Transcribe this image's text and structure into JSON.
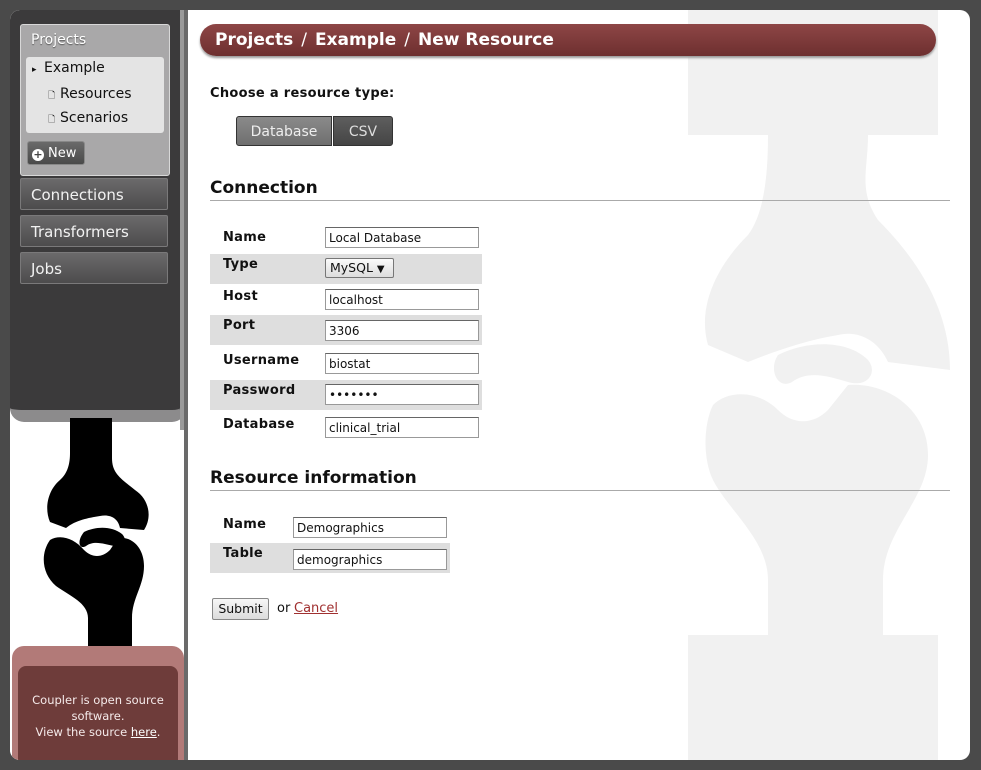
{
  "sidebar": {
    "projects_title": "Projects",
    "tree": [
      {
        "label": "Example",
        "glyph": "▸"
      },
      {
        "label": "Resources",
        "glyph": "🗋"
      },
      {
        "label": "Scenarios",
        "glyph": "🗋"
      }
    ],
    "new_label": "New",
    "nav": [
      "Connections",
      "Transformers",
      "Jobs"
    ]
  },
  "footer": {
    "line1": "Coupler is open source software.",
    "line2_prefix": "View the source ",
    "link": "here",
    "line2_suffix": "."
  },
  "breadcrumb": [
    "Projects",
    "Example",
    "New Resource"
  ],
  "breadcrumb_sep": "/",
  "resource_type": {
    "prompt": "Choose a resource type:",
    "options": [
      "Database",
      "CSV"
    ],
    "selected": "Database"
  },
  "connection": {
    "heading": "Connection",
    "fields": [
      {
        "label": "Name",
        "value": "Local Database"
      },
      {
        "label": "Type",
        "value": "MySQL"
      },
      {
        "label": "Host",
        "value": "localhost"
      },
      {
        "label": "Port",
        "value": "3306"
      },
      {
        "label": "Username",
        "value": "biostat"
      },
      {
        "label": "Password",
        "value": "•••••••"
      },
      {
        "label": "Database",
        "value": "clinical_trial"
      }
    ]
  },
  "resource_info": {
    "heading": "Resource information",
    "fields": [
      {
        "label": "Name",
        "value": "Demographics"
      },
      {
        "label": "Table",
        "value": "demographics"
      }
    ]
  },
  "actions": {
    "submit": "Submit",
    "or": "or",
    "cancel": "Cancel"
  },
  "colors": {
    "accent": "#7a3838",
    "sidebar_bg": "#3b3a3b",
    "footer_bg": "#6e3c3a"
  }
}
